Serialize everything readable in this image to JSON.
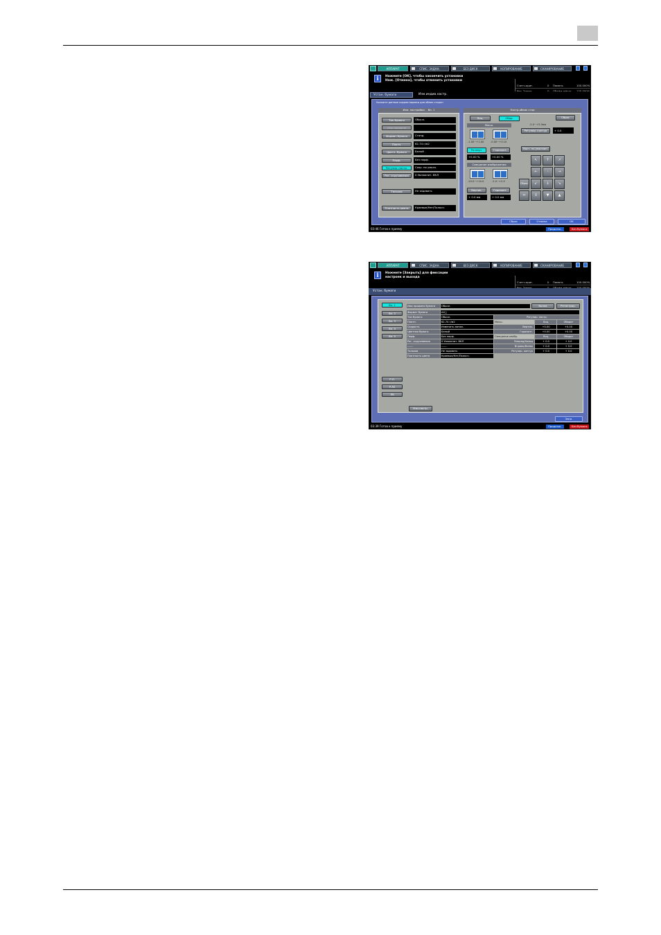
{
  "page": {
    "page_box_label": ""
  },
  "screen1": {
    "tabs": [
      "АППАРАТ",
      "СПИС. ЗАДАН.",
      "БЕЗ ДИСК",
      "КОПИРОВАНИЕ",
      "СКАНИРОВАНИЕ"
    ],
    "message": "Нажмите [OK], чтобы закончить установки\nНаж. [Отмена], чтобы отменить установки",
    "counters": [
      {
        "label": "Счетч.ориг.",
        "value": "0",
        "label2": "Память",
        "value2": "100.000%"
      },
      {
        "label": "Рез. Зомон.",
        "value": "0",
        "label2": "Объём жёстк",
        "value2": "100.000%"
      }
    ],
    "breadcrumb": [
      "Устан. бумаги",
      "Изм.индив.настр."
    ],
    "instruction": "Укажите данные корректировки для обеих сторон",
    "left_header": [
      "Изм. настройки",
      "Вл. 1"
    ],
    "fields": [
      {
        "button": "Тип бумаги",
        "value": "Обычн."
      },
      {
        "button": "Имя профиля",
        "value": ""
      },
      {
        "button": "Формат бумаги",
        "value": "Станд."
      },
      {
        "button": "Плотн.",
        "value": "62-74 г/м2"
      },
      {
        "button": "Цветн. бумага",
        "value": "Белый"
      },
      {
        "button": "Перф.",
        "value": "Без перф."
      },
      {
        "button": "Регулир. настр.",
        "value": "Сохр. по умолч."
      },
      {
        "button": "Рег. скручивания",
        "value": "0  Увлажнит.   ВКЛ"
      },
      {
        "button": "Тальков",
        "value": "Не задавать"
      },
      {
        "button": "Плотность цвета",
        "value": "Краевые/Нет/Полосн."
      }
    ],
    "right_header": "Настр.обеих стор",
    "side_tabs": [
      "Лиц.",
      "Обор."
    ],
    "reset_button": "Сброс",
    "section_scale": "Масш.",
    "scale_ranges": [
      "-1.00~+1.00",
      "-0.00~+0.10"
    ],
    "vert_button": "По верт.",
    "horiz_button": "Горизонт.",
    "scale_values": [
      "+0.00 %",
      "+0.00 %"
    ],
    "section_shift": "Смещение изображения",
    "shift_ranges": [
      "-10.0~+10.0",
      "-2.0~+2.0"
    ],
    "shift_buttons": [
      "Вертик.",
      "Горизонт."
    ],
    "shift_values": [
      "+ 0.0 мм",
      "+ 0.0 мм"
    ],
    "range_top": "-5.0~+5.0мм",
    "adj_button": "Регулир. контур",
    "adj_value": "+ 0.0",
    "restore_button": "Вост. по умолчан.",
    "keypad": [
      "↖",
      "↑",
      "↗",
      "←",
      "·",
      "→",
      "↙",
      "↓",
      "↘"
    ],
    "keypad_extra": [
      "Сброс",
      "↔",
      "↕",
      "▼",
      "▲"
    ],
    "footer_buttons": [
      "Сброс",
      "Отмена",
      "OK"
    ],
    "status": "03:46  Готов к приему",
    "ready": "Продолж.",
    "error": "Без бумаги"
  },
  "screen2": {
    "tabs": [
      "АППАРАТ",
      "СПИС. ЗАДАН.",
      "БЕЗ ДИСК",
      "КОПИРОВАНИЕ",
      "СКАНИРОВАНИЕ"
    ],
    "message": "Нажмите [Закрыть] для фиксации\nнастроек и выхода",
    "counters": [
      {
        "label": "Счетч.ориг.",
        "value": "0",
        "label2": "Память",
        "value2": "100.000%"
      },
      {
        "label": "Рез. Зомон.",
        "value": "0",
        "label2": "Объём жёстк",
        "value2": "100.000%"
      }
    ],
    "breadcrumb": [
      "Устан. бумаги"
    ],
    "trays": [
      "Вл. 1",
      "Вл. 2",
      "Вл. 3",
      "Вл. 4",
      "Вл. 5"
    ],
    "extra_trays": [
      "Р.Л.",
      "Р.Л2",
      "Лб"
    ],
    "profile_label": "Имя профиля бумаги",
    "profile_value": "Обычн.",
    "recall_button": "Вызов",
    "register_button": "Регистрир.",
    "rows": [
      {
        "label": "Формат бумаги",
        "value": "A4▢"
      },
      {
        "label": "Тип бумаги",
        "value": "Обычн."
      },
      {
        "label": "Плотн.",
        "value": "62-74 г/м2"
      },
      {
        "label": "Скорость",
        "value": "Изменить автом."
      },
      {
        "label": "Цветная бумага",
        "value": "Белый"
      },
      {
        "label": "Перф.",
        "value": "Без перф."
      },
      {
        "label": "Рег. скручивания",
        "value": "0  Увлажнит.   ВКЛ"
      },
      {
        "label": "------",
        "value": "------"
      },
      {
        "label": "Тальков",
        "value": "Не задавать"
      },
      {
        "label": "Плотность цвета",
        "value": "Краевые/Нет/Полосн."
      }
    ],
    "adj_header": "Регулир. настр.",
    "adj_cols": [
      "Лиц.",
      "Оборот"
    ],
    "adj_rows": [
      {
        "group": "Масш.",
        "label": "Вертик.",
        "front": "+0.00",
        "back": "+0.00"
      },
      {
        "group": "",
        "label": "Горизонт.",
        "front": "+0.00",
        "back": "+0.00"
      },
      {
        "group": "Смещение изобр.",
        "label": "",
        "front": "Лиц.",
        "back": "Оборот"
      },
      {
        "group": "",
        "label": "Вперед/Назад",
        "front": "+ 0.0",
        "back": "+ 0.0"
      },
      {
        "group": "",
        "label": "Вправо/Влево",
        "front": "+ 0.0",
        "back": "+ 0.0"
      },
      {
        "group": "",
        "label": "Регулир. контур",
        "front": "+ 0.0",
        "back": "+ 0.0"
      }
    ],
    "change_button": "Изм.настр.",
    "close_button": "Закр.",
    "status": "03:39  Готов к приему",
    "ready": "Продолж.",
    "error": "Без бумаги"
  }
}
